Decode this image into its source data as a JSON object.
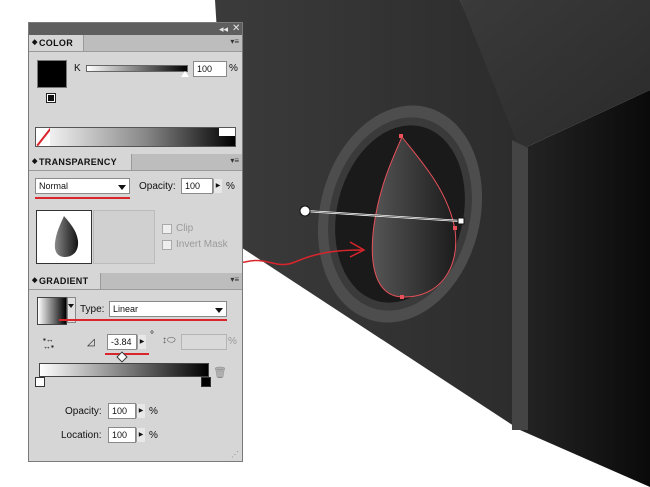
{
  "color_panel": {
    "tab": "COLOR",
    "channel_label": "K",
    "value": "100",
    "unit": "%"
  },
  "transparency_panel": {
    "tab": "TRANSPARENCY",
    "blend_mode": "Normal",
    "opacity_label": "Opacity:",
    "opacity_value": "100",
    "opacity_unit": "%",
    "clip_label": "Clip",
    "invert_mask_label": "Invert Mask"
  },
  "gradient_panel": {
    "tab": "GRADIENT",
    "type_label": "Type:",
    "type_value": "Linear",
    "angle_value": "-3.84",
    "angle_unit": "°",
    "aspect_unit": "%",
    "stop_opacity_label": "Opacity:",
    "stop_opacity_value": "100",
    "stop_opacity_unit": "%",
    "location_label": "Location:",
    "location_value": "100",
    "location_unit": "%"
  },
  "colors": {
    "annotation_red": "#d9252c",
    "panel_bg": "#d6d6d6",
    "titlebar": "#5e5e5e",
    "object_dark": "#2f2f2f"
  },
  "icons": [
    "collapse-icon",
    "close-icon",
    "panel-menu-icon",
    "angle-icon",
    "aspect-ratio-icon",
    "trash-icon",
    "none-swatch-icon",
    "reverse-gradient-icon"
  ]
}
